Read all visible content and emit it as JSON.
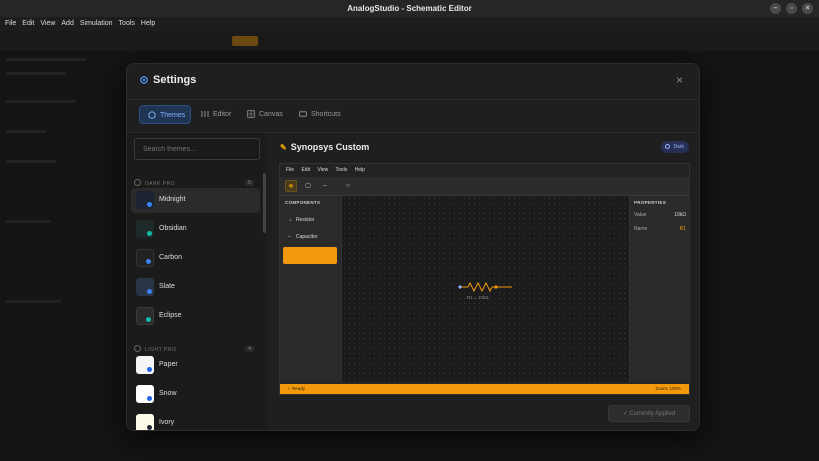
{
  "window": {
    "title": "AnalogStudio - Schematic Editor",
    "controls": [
      "–",
      "▫",
      "×"
    ]
  },
  "menubar": [
    "File",
    "Edit",
    "View",
    "Add",
    "Simulation",
    "Tools",
    "Help"
  ],
  "dialog": {
    "title": "Settings",
    "close": "×",
    "tabs": [
      {
        "label": "Themes",
        "icon": "palette-icon",
        "active": true
      },
      {
        "label": "Editor",
        "icon": "sliders-icon",
        "active": false
      },
      {
        "label": "Canvas",
        "icon": "grid-icon",
        "active": false
      },
      {
        "label": "Shortcuts",
        "icon": "keyboard-icon",
        "active": false
      }
    ],
    "search": {
      "placeholder": "Search themes..."
    },
    "groups": [
      {
        "label": "DARK PRO",
        "count": "5"
      },
      {
        "label": "LIGHT PRO",
        "count": "4"
      }
    ],
    "dark_themes": [
      {
        "name": "Midnight",
        "bg": "#1c2433",
        "dot": "#3b82f6"
      },
      {
        "name": "Obsidian",
        "bg": "#1e2a2a",
        "dot": "#14b8a6"
      },
      {
        "name": "Carbon",
        "bg": "#222222",
        "dot": "#3b82f6"
      },
      {
        "name": "Slate",
        "bg": "#2a3447",
        "dot": "#3b82f6"
      },
      {
        "name": "Eclipse",
        "bg": "#2b2b2b",
        "dot": "#14b8a6"
      }
    ],
    "light_themes": [
      {
        "name": "Paper",
        "bg": "#f5f5f5",
        "dot": "#2563eb"
      },
      {
        "name": "Snow",
        "bg": "#ffffff",
        "dot": "#2563eb"
      },
      {
        "name": "Ivory",
        "bg": "#fffbea",
        "dot": "#1f2937"
      }
    ],
    "preview": {
      "title": "Synopsys Custom",
      "badge": "Dark",
      "menu": [
        "File",
        "Edit",
        "View",
        "Tools",
        "Help"
      ],
      "components_header": "COMPONENTS",
      "components": [
        {
          "label": "Resistor",
          "icon": "⊥"
        },
        {
          "label": "Capacitor",
          "icon": "⫞"
        }
      ],
      "properties_header": "PROPERTIES",
      "properties": [
        {
          "key": "Value",
          "value": "10kΩ"
        },
        {
          "key": "Name",
          "value": "R1"
        }
      ],
      "wire_label": "R1 = 10kΩ",
      "status_left": "✓ Ready",
      "status_right": "Zoom: 100%"
    },
    "applied_button": "✓  Currently Applied",
    "accent": "#f29a0c"
  }
}
